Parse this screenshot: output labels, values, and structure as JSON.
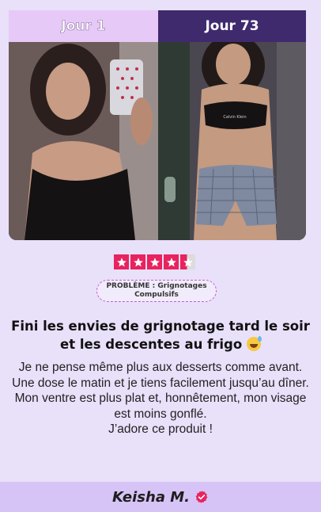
{
  "comparison": {
    "before_label": "Jour 1",
    "after_label": "Jour 73"
  },
  "rating": {
    "stars": 4.5,
    "max": 5,
    "color": "#e8235e"
  },
  "problem_badge": {
    "label": "PROBLÈME : Grignotages Compulsifs"
  },
  "headline": "Fini les envies de grignotage tard le soir et les descentes au frigo",
  "headline_emoji": "grinning-sweat-icon",
  "body_lines": [
    "Je ne pense même plus aux desserts comme avant.",
    "Une dose le matin et je tiens facilement jusqu’au dîner.",
    "Mon ventre est plus plat et, honnêtement, mon visage est moins gonflé.",
    "J’adore ce produit !"
  ],
  "author": {
    "name": "Keisha M.",
    "badge_icon": "verified-check-icon",
    "badge_color": "#e8235e"
  },
  "colors": {
    "background": "#e9e0fa",
    "footer": "#d7c4f7",
    "tab_before": "#e7c9f7",
    "tab_after": "#3f2a6e"
  }
}
